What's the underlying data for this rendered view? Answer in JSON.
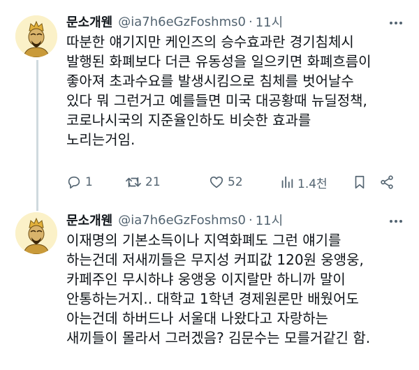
{
  "tweets": [
    {
      "author": {
        "name": "문소개웬",
        "handle": "@ia7h6eGzFoshms0",
        "separator": "·",
        "time": "11시"
      },
      "text_lines": [
        "따분한 얘기지만 케인즈의 승수효과란 경기침체시",
        "발행된 화폐보다 더큰 유동성을 일으키면 화폐흐름이",
        "좋아져 초과수요를 발생시킴으로 침체를 벗어날수",
        "있다 뭐 그런거고 예를들면 미국 대공황때 뉴딜정책,",
        "코로나시국의 지준율인하도 비슷한 효과를",
        "노리는거임."
      ],
      "stats": {
        "replies": "1",
        "retweets": "21",
        "likes": "52",
        "views": "1.4천"
      }
    },
    {
      "author": {
        "name": "문소개웬",
        "handle": "@ia7h6eGzFoshms0",
        "separator": "·",
        "time": "11시"
      },
      "text_lines": [
        "이재명의 기본소득이나 지역화폐도 그런 얘기를",
        "하는건데 저새끼들은 무지성 커피값 120원 웅앵웅,",
        "카페주인 무시하냐 웅앵웅 이지랄만 하니까 말이",
        "안통하는거지.. 대학교 1학년 경제원론만 배웠어도",
        "아는건데 하버드나 서울대 나왔다고 자랑하는",
        "새끼들이 몰라서 그러겠음? 김문수는 모를거같긴 함."
      ]
    }
  ],
  "icons": {
    "reply": "reply-icon",
    "retweet": "retweet-icon",
    "like": "heart-icon",
    "views": "views-icon",
    "bookmark": "bookmark-icon",
    "share": "share-icon",
    "more": "more-icon"
  },
  "colors": {
    "text": "#0f1419",
    "secondary": "#536471",
    "thread_line": "#cfd9de"
  }
}
